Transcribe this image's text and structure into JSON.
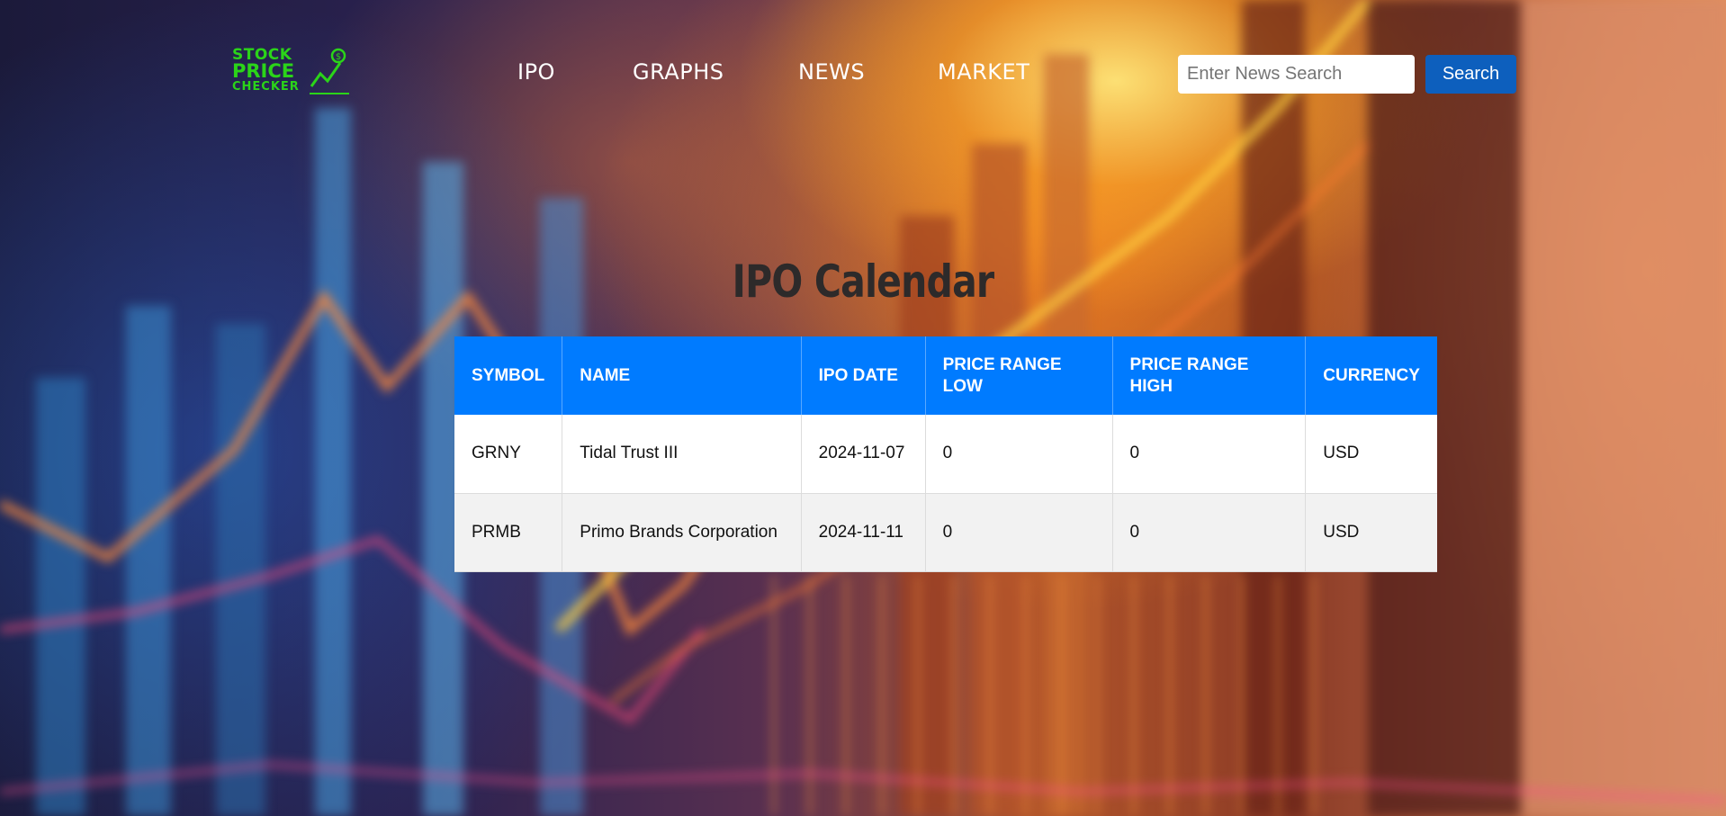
{
  "logo": {
    "line1": "STOCK",
    "line2": "PRICE",
    "line3": "CHECKER"
  },
  "nav": {
    "items": [
      "IPO",
      "GRAPHS",
      "NEWS",
      "MARKET"
    ]
  },
  "search": {
    "placeholder": "Enter News Search",
    "value": "",
    "button_label": "Search"
  },
  "page": {
    "title": "IPO Calendar"
  },
  "table": {
    "headers": [
      "SYMBOL",
      "NAME",
      "IPO DATE",
      "PRICE RANGE LOW",
      "PRICE RANGE HIGH",
      "CURRENCY"
    ],
    "rows": [
      [
        "GRNY",
        "Tidal Trust III",
        "2024-11-07",
        "0",
        "0",
        "USD"
      ],
      [
        "PRMB",
        "Primo Brands Corporation",
        "2024-11-11",
        "0",
        "0",
        "USD"
      ]
    ]
  },
  "colors": {
    "accent": "#007bff",
    "search_button": "#0d5fbd",
    "logo": "#2bd419"
  }
}
